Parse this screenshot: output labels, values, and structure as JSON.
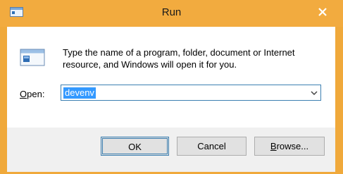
{
  "window": {
    "title": "Run",
    "title_icon": "run-icon",
    "close_icon": "close-icon"
  },
  "description": {
    "line1": "Type the name of a program, folder, document or Internet",
    "line2": "resource, and Windows will open it for you."
  },
  "open_field": {
    "label_mnemonic": "O",
    "label_rest": "pen:",
    "value": "devenv",
    "dropdown_icon": "chevron-down-icon"
  },
  "buttons": {
    "ok": "OK",
    "cancel": "Cancel",
    "browse_mnemonic": "B",
    "browse_rest": "rowse..."
  },
  "colors": {
    "titlebar": "#f2ab3f",
    "selection": "#3399ff",
    "focus_border": "#3c7fb1"
  }
}
